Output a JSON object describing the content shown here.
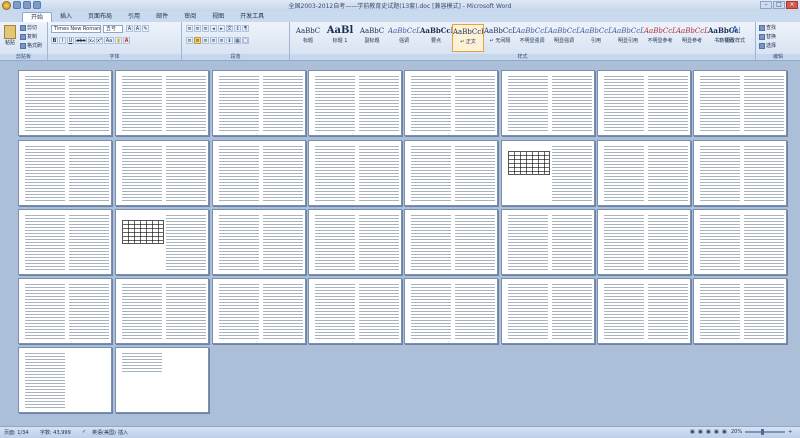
{
  "window": {
    "title": "全国2003-2012自考——学前教育史试题(13套).doc [兼容模式] - Microsoft Word",
    "min": "–",
    "max": "□",
    "close": "×"
  },
  "tabs": [
    "开始",
    "插入",
    "页面布局",
    "引用",
    "邮件",
    "审阅",
    "视图",
    "开发工具"
  ],
  "ribbon": {
    "clipboard": {
      "group": "剪贴板",
      "paste": "粘贴",
      "cut": "剪切",
      "copy": "复制",
      "format_painter": "格式刷"
    },
    "font": {
      "group": "字体",
      "font_name": "Times New Roman",
      "font_size": "五号",
      "bold": "B",
      "italic": "I",
      "underline": "U",
      "strike": "abe",
      "sub": "x₂",
      "sup": "x²",
      "aa": "Aa",
      "color_a": "A",
      "grow": "A",
      "shrink": "A"
    },
    "paragraph": {
      "group": "段落"
    },
    "styles": {
      "group": "样式",
      "items": [
        {
          "sample": "AaBbC",
          "name": "标题"
        },
        {
          "sample": "AaBl",
          "name": "标题 1"
        },
        {
          "sample": "AaBbC",
          "name": "副标题"
        },
        {
          "sample": "AaBbCcD",
          "name": "强调"
        },
        {
          "sample": "AaBbCcD",
          "name": "要点"
        },
        {
          "sample": "AaBbCcDc",
          "name": "↵ 正文"
        },
        {
          "sample": "AaBbCcDc",
          "name": "↵ 无间隔"
        },
        {
          "sample": "AaBbCcD",
          "name": "不明显强调"
        },
        {
          "sample": "AaBbCcD",
          "name": "明显强调"
        },
        {
          "sample": "AaBbCcD",
          "name": "引用"
        },
        {
          "sample": "AaBbCcD",
          "name": "明显引用"
        },
        {
          "sample": "AaBbCcD",
          "name": "不明显参考"
        },
        {
          "sample": "AaBbCcD",
          "name": "明显参考"
        },
        {
          "sample": "AaBbCcI",
          "name": "书籍标题"
        }
      ],
      "change_styles": "更改样式"
    },
    "editing": {
      "group": "编辑",
      "find": "查找",
      "replace": "替换",
      "select": "选择"
    }
  },
  "status": {
    "page": "页面: 1/34",
    "words": "字数: 43,999",
    "lang": "英语(美国)",
    "insert": "插入",
    "zoom": "20%"
  }
}
